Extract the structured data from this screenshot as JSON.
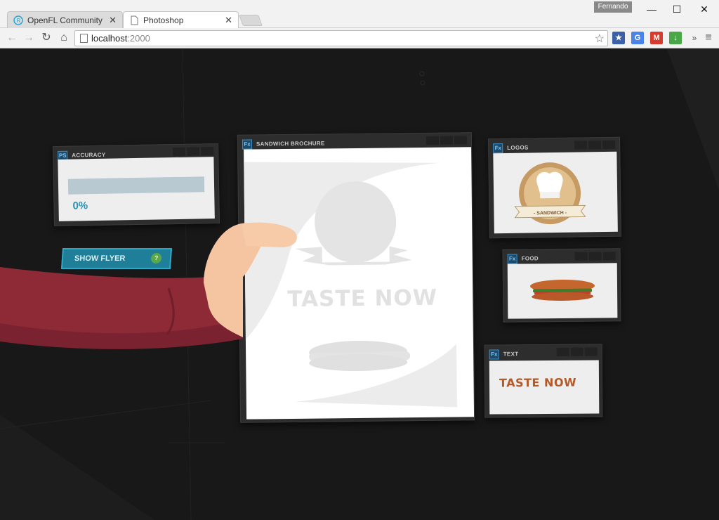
{
  "browser": {
    "tabs": [
      {
        "label": "OpenFL Community"
      },
      {
        "label": "Photoshop"
      }
    ],
    "profile_name": "Fernando",
    "url_host": "localhost",
    "url_port": ":2000"
  },
  "panels": {
    "accuracy": {
      "badge": "PS",
      "title": "ACCURACY",
      "value": "0%",
      "progress": 0
    },
    "brochure": {
      "badge": "Fx",
      "title": "SANDWICH BROCHURE",
      "headline": "TASTE NOW"
    },
    "logos": {
      "badge": "Fx",
      "title": "LOGOS",
      "logo_text": "- SANDWICH -"
    },
    "food": {
      "badge": "Fx",
      "title": "FOOD"
    },
    "text": {
      "badge": "Fx",
      "title": "TEXT",
      "content": "TASTE NOW"
    }
  },
  "buttons": {
    "show_flyer": "SHOW FLYER",
    "help": "?"
  },
  "colors": {
    "accent_teal": "#1f7f98",
    "badge_blue": "#3c8fc4",
    "taste_brown": "#b35a2a",
    "sleeve_red": "#8e2a35",
    "skin": "#f5c4a0"
  }
}
